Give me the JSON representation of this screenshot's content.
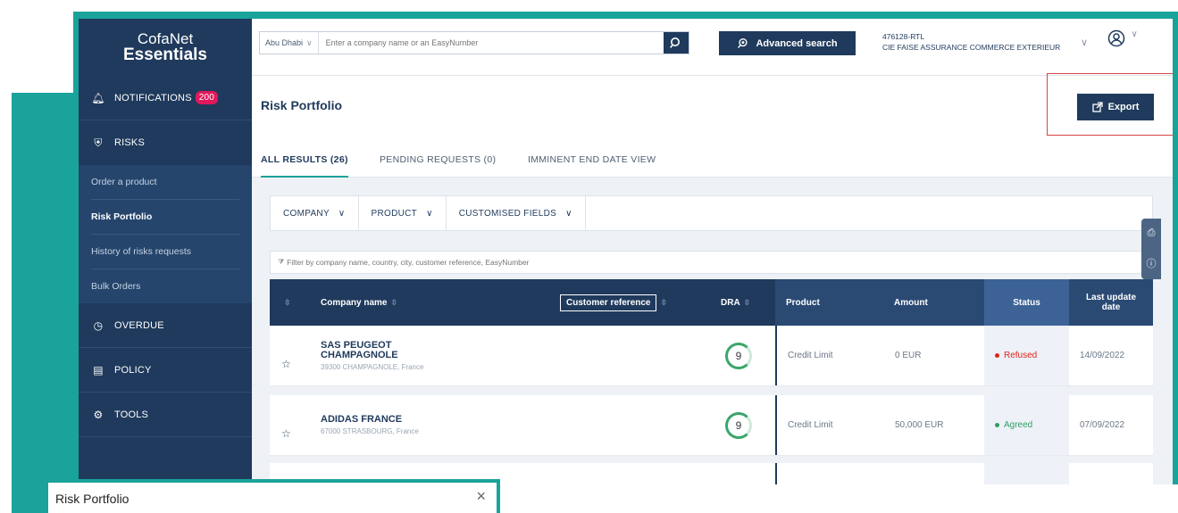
{
  "sidebar": {
    "logo_line1": "CofaNet",
    "logo_line2": "Essentials",
    "notifications_label": "NOTIFICATIONS",
    "notifications_count": "200",
    "risks_label": "RISKS",
    "sub_items": [
      "Order a product",
      "Risk Portfolio",
      "History of risks requests",
      "Bulk Orders"
    ],
    "overdue_label": "OVERDUE",
    "policy_label": "POLICY",
    "tools_label": "TOOLS"
  },
  "topbar": {
    "location": "Abu Dhabi",
    "search_placeholder": "Enter a company name or an EasyNumber",
    "advanced_search": "Advanced search",
    "account_id": "476128-RTL",
    "account_name": "CIE FAISE ASSURANCE COMMERCE EXTERIEUR"
  },
  "page": {
    "title": "Risk Portfolio",
    "export_label": "Export"
  },
  "tabs": [
    "ALL RESULTS (26)",
    "PENDING REQUESTS (0)",
    "IMMINENT END DATE VIEW"
  ],
  "filters": [
    "COMPANY",
    "PRODUCT",
    "CUSTOMISED FIELDS"
  ],
  "filter_placeholder": "Filter by company name, country, city, customer reference, EasyNumber",
  "table": {
    "headers": {
      "company": "Company name",
      "customer_ref": "Customer reference",
      "dra": "DRA",
      "product": "Product",
      "amount": "Amount",
      "status": "Status",
      "last_update": "Last update date"
    },
    "rows": [
      {
        "name": "SAS PEUGEOT CHAMPAGNOLE",
        "address": "39300 CHAMPAGNOLE, France",
        "dra": "9",
        "product": "Credit Limit",
        "amount": "0 EUR",
        "status": "Refused",
        "date": "14/09/2022"
      },
      {
        "name": "ADIDAS FRANCE",
        "address": "67000 STRASBOURG, France",
        "dra": "9",
        "product": "Credit Limit",
        "amount": "50,000 EUR",
        "status": "Agreed",
        "date": "07/09/2022"
      }
    ]
  },
  "colors": {
    "teal": "#1aa39a",
    "navy": "#1f3a5c",
    "refused": "#e2231a",
    "agreed": "#2f9e62"
  },
  "modal": {
    "title": "Risk Portfolio",
    "close": "×"
  }
}
